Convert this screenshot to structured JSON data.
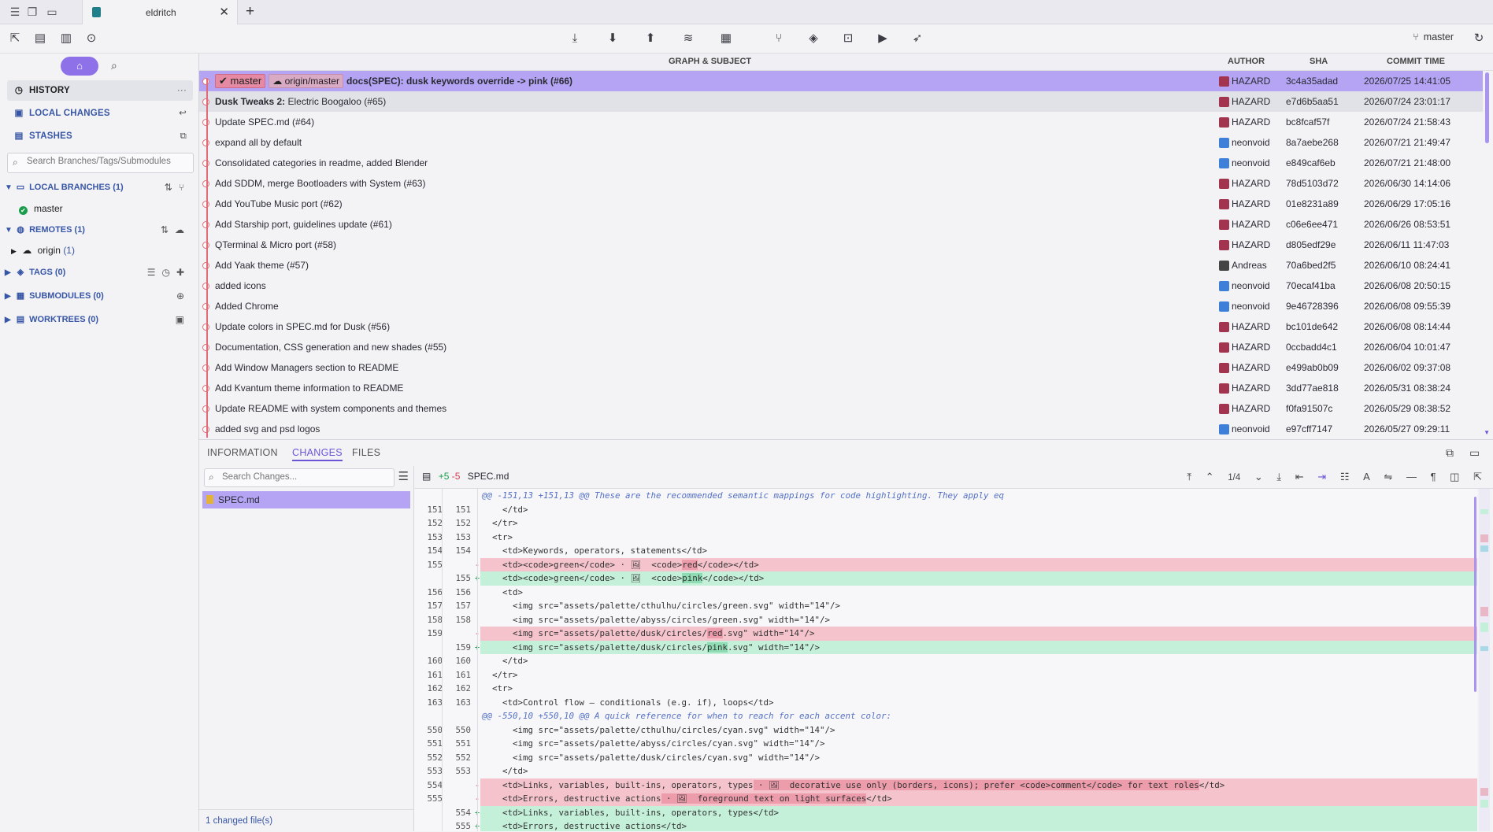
{
  "tab": {
    "title": "eldritch"
  },
  "branch_indicator": "master",
  "sidebar": {
    "nav": [
      {
        "label": "HISTORY"
      },
      {
        "label": "LOCAL CHANGES"
      },
      {
        "label": "STASHES"
      }
    ],
    "search_placeholder": "Search Branches/Tags/Submodules",
    "local_branches": "LOCAL BRANCHES",
    "local_branches_count": "(1)",
    "branch_master": "master",
    "remotes": "REMOTES",
    "remotes_count": "(1)",
    "remote_origin": "origin",
    "remote_origin_count": "(1)",
    "tags": "TAGS",
    "tags_count": "(0)",
    "submodules": "SUBMODULES",
    "submodules_count": "(0)",
    "worktrees": "WORKTREES",
    "worktrees_count": "(0)"
  },
  "commit_header": {
    "graph": "GRAPH & SUBJECT",
    "author": "AUTHOR",
    "sha": "SHA",
    "time": "COMMIT TIME"
  },
  "refs": {
    "master": "master",
    "origin": "origin/master"
  },
  "commits": [
    {
      "subject": "docs(SPEC): dusk keywords override -> pink (#66)",
      "author": "HAZARD",
      "sha": "3c4a35adad",
      "time": "2026/07/25 14:41:05"
    },
    {
      "subject_bold": "Dusk Tweaks 2:",
      "subject": "Electric Boogaloo (#65)",
      "author": "HAZARD",
      "sha": "e7d6b5aa51",
      "time": "2026/07/24 23:01:17"
    },
    {
      "subject": "Update SPEC.md (#64)",
      "author": "HAZARD",
      "sha": "bc8fcaf57f",
      "time": "2026/07/24 21:58:43"
    },
    {
      "subject": "expand all by default",
      "author": "neonvoid",
      "sha": "8a7aebe268",
      "time": "2026/07/21 21:49:47"
    },
    {
      "subject": "Consolidated categories in readme, added Blender",
      "author": "neonvoid",
      "sha": "e849caf6eb",
      "time": "2026/07/21 21:48:00"
    },
    {
      "subject": "Add SDDM, merge Bootloaders with System (#63)",
      "author": "HAZARD",
      "sha": "78d5103d72",
      "time": "2026/06/30 14:14:06"
    },
    {
      "subject": "Add YouTube Music port (#62)",
      "author": "HAZARD",
      "sha": "01e8231a89",
      "time": "2026/06/29 17:05:16"
    },
    {
      "subject": "Add Starship port, guidelines update (#61)",
      "author": "HAZARD",
      "sha": "c06e6ee471",
      "time": "2026/06/26 08:53:51"
    },
    {
      "subject": "QTerminal & Micro port (#58)",
      "author": "HAZARD",
      "sha": "d805edf29e",
      "time": "2026/06/11 11:47:03"
    },
    {
      "subject": "Add Yaak theme (#57)",
      "author": "Andreas",
      "sha": "70a6bed2f5",
      "time": "2026/06/10 08:24:41"
    },
    {
      "subject": "added icons",
      "author": "neonvoid",
      "sha": "70ecaf41ba",
      "time": "2026/06/08 20:50:15"
    },
    {
      "subject": "Added Chrome",
      "author": "neonvoid",
      "sha": "9e46728396",
      "time": "2026/06/08 09:55:39"
    },
    {
      "subject": "Update colors in SPEC.md for Dusk (#56)",
      "author": "HAZARD",
      "sha": "bc101de642",
      "time": "2026/06/08 08:14:44"
    },
    {
      "subject": "Documentation, CSS generation and new shades (#55)",
      "author": "HAZARD",
      "sha": "0ccbadd4c1",
      "time": "2026/06/04 10:01:47"
    },
    {
      "subject": "Add Window Managers section to README",
      "author": "HAZARD",
      "sha": "e499ab0b09",
      "time": "2026/06/02 09:37:08"
    },
    {
      "subject": "Add Kvantum theme information to README",
      "author": "HAZARD",
      "sha": "3dd77ae818",
      "time": "2026/05/31 08:38:24"
    },
    {
      "subject": "Update README with system components and themes",
      "author": "HAZARD",
      "sha": "f0fa91507c",
      "time": "2026/05/29 08:38:52"
    },
    {
      "subject": "added svg and psd logos",
      "author": "neonvoid",
      "sha": "e97cff7147",
      "time": "2026/05/27 09:29:11"
    }
  ],
  "detail_tabs": [
    "INFORMATION",
    "CHANGES",
    "FILES"
  ],
  "changes": {
    "search_placeholder": "Search Changes...",
    "file": "SPEC.md",
    "footer": "1 changed file(s)"
  },
  "diff": {
    "file": "SPEC.md",
    "added": "+5",
    "removed": "-5",
    "page": "1/4",
    "lines": [
      {
        "k": "hunk",
        "t": "@@ -151,13 +151,13 @@ These are the recommended semantic mappings for code highlighting. They apply eq"
      },
      {
        "k": "ctx",
        "a": "151",
        "b": "151",
        "t": "    </td>"
      },
      {
        "k": "ctx",
        "a": "152",
        "b": "152",
        "t": "  </tr>"
      },
      {
        "k": "ctx",
        "a": "153",
        "b": "153",
        "t": "  <tr>"
      },
      {
        "k": "ctx",
        "a": "154",
        "b": "154",
        "t": "    <td>Keywords, operators, statements</td>"
      },
      {
        "k": "del",
        "a": "155",
        "b": "",
        "m": "-",
        "pre": "    <td><code>green</code> · 🖼  <code>",
        "hl": "red",
        "post": "</code></td>"
      },
      {
        "k": "ins",
        "a": "",
        "b": "155",
        "m": "+",
        "pre": "    <td><code>green</code> · 🖼  <code>",
        "hl": "pink",
        "post": "</code></td>"
      },
      {
        "k": "ctx",
        "a": "156",
        "b": "156",
        "t": "    <td>"
      },
      {
        "k": "ctx",
        "a": "157",
        "b": "157",
        "t": "      <img src=\"assets/palette/cthulhu/circles/green.svg\" width=\"14\"/>"
      },
      {
        "k": "ctx",
        "a": "158",
        "b": "158",
        "t": "      <img src=\"assets/palette/abyss/circles/green.svg\" width=\"14\"/>"
      },
      {
        "k": "del",
        "a": "159",
        "b": "",
        "m": "-",
        "pre": "      <img src=\"assets/palette/dusk/circles/",
        "hl": "red",
        "post": ".svg\" width=\"14\"/>"
      },
      {
        "k": "ins",
        "a": "",
        "b": "159",
        "m": "+",
        "pre": "      <img src=\"assets/palette/dusk/circles/",
        "hl": "pink",
        "post": ".svg\" width=\"14\"/>"
      },
      {
        "k": "ctx",
        "a": "160",
        "b": "160",
        "t": "    </td>"
      },
      {
        "k": "ctx",
        "a": "161",
        "b": "161",
        "t": "  </tr>"
      },
      {
        "k": "ctx",
        "a": "162",
        "b": "162",
        "t": "  <tr>"
      },
      {
        "k": "ctx",
        "a": "163",
        "b": "163",
        "t": "    <td>Control flow — conditionals (e.g. if), loops</td>"
      },
      {
        "k": "hunk",
        "t": "@@ -550,10 +550,10 @@ A quick reference for when to reach for each accent color:"
      },
      {
        "k": "ctx",
        "a": "550",
        "b": "550",
        "t": "      <img src=\"assets/palette/cthulhu/circles/cyan.svg\" width=\"14\"/>"
      },
      {
        "k": "ctx",
        "a": "551",
        "b": "551",
        "t": "      <img src=\"assets/palette/abyss/circles/cyan.svg\" width=\"14\"/>"
      },
      {
        "k": "ctx",
        "a": "552",
        "b": "552",
        "t": "      <img src=\"assets/palette/dusk/circles/cyan.svg\" width=\"14\"/>"
      },
      {
        "k": "ctx",
        "a": "553",
        "b": "553",
        "t": "    </td>"
      },
      {
        "k": "del",
        "a": "554",
        "b": "",
        "m": "-",
        "pre": "    <td>Links, variables, built-ins, operators, types",
        "hl": " · 🖼  decorative use only (borders, icons); prefer <code>comment</code> for text roles",
        "post": "</td>"
      },
      {
        "k": "del",
        "a": "555",
        "b": "",
        "m": "-",
        "pre": "    <td>Errors, destructive actions",
        "hl": " · 🖼  foreground text on light surfaces",
        "post": "</td>"
      },
      {
        "k": "ins",
        "a": "",
        "b": "554",
        "m": "+",
        "pre": "    <td>Links, variables, built-ins, operators, types</td>",
        "hl": "",
        "post": ""
      },
      {
        "k": "ins",
        "a": "",
        "b": "555",
        "m": "+",
        "pre": "    <td>Errors, destructive actions</td>",
        "hl": "",
        "post": ""
      }
    ]
  },
  "colors": {
    "accent": "#8e71e8",
    "selected_row": "#b4a4f3",
    "graph": "#e36b78",
    "del_bg": "#f4c3cb",
    "ins_bg": "#c4efd9"
  }
}
